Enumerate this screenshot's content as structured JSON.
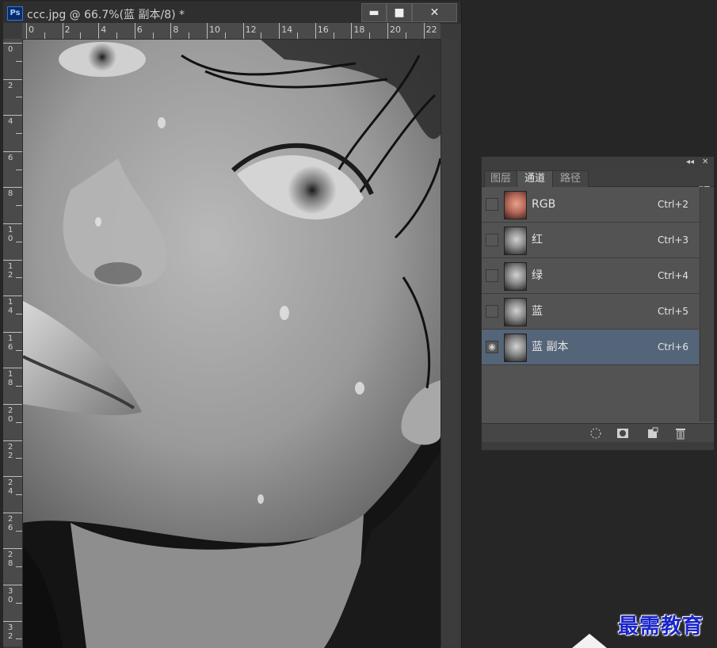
{
  "document": {
    "title": "ccc.jpg @ 66.7%(蓝 副本/8) *",
    "app_logo": "Ps",
    "window_buttons": {
      "minimize": "▬",
      "maximize": "■",
      "close": "✕"
    }
  },
  "rulers": {
    "top": [
      "0",
      "2",
      "4",
      "6",
      "8",
      "10",
      "12",
      "14",
      "16",
      "18",
      "20",
      "22"
    ],
    "left": [
      "0",
      "2",
      "4",
      "6",
      "8",
      "1\n0",
      "1\n2",
      "1\n4",
      "1\n6",
      "1\n8",
      "2\n0",
      "2\n2",
      "2\n4",
      "2\n6",
      "2\n8",
      "3\n0",
      "3\n2"
    ]
  },
  "panel": {
    "collapse_icon": "◂◂",
    "close_icon": "✕",
    "menu_icon": "▾≡",
    "tabs": [
      {
        "label": "图层",
        "active": false
      },
      {
        "label": "通道",
        "active": true
      },
      {
        "label": "路径",
        "active": false
      }
    ],
    "channels": [
      {
        "name": "RGB",
        "shortcut": "Ctrl+2",
        "visible": false,
        "selected": false,
        "thumb": "color"
      },
      {
        "name": "红",
        "shortcut": "Ctrl+3",
        "visible": false,
        "selected": false,
        "thumb": "gray"
      },
      {
        "name": "绿",
        "shortcut": "Ctrl+4",
        "visible": false,
        "selected": false,
        "thumb": "gray"
      },
      {
        "name": "蓝",
        "shortcut": "Ctrl+5",
        "visible": false,
        "selected": false,
        "thumb": "gray"
      },
      {
        "name": "蓝 副本",
        "shortcut": "Ctrl+6",
        "visible": true,
        "selected": true,
        "thumb": "gray"
      }
    ],
    "bottom_buttons": [
      "load-selection-icon",
      "save-selection-icon",
      "new-channel-icon",
      "delete-icon"
    ]
  },
  "watermark": "最需教育"
}
